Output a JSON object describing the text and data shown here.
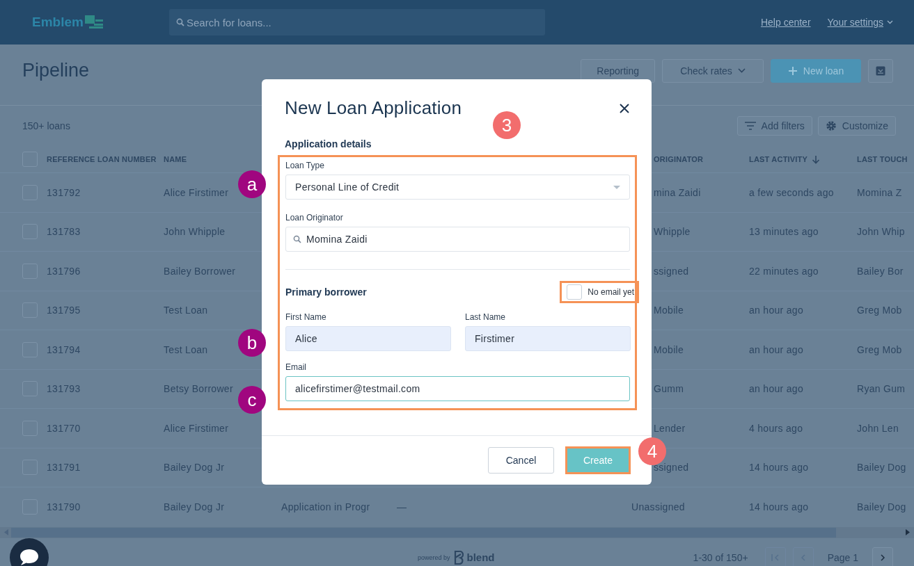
{
  "app": {
    "logo": "Emblem",
    "search_placeholder": "Search for loans...",
    "links": [
      {
        "label": "Help center",
        "kind": "link"
      },
      {
        "label": "Your settings",
        "kind": "menu"
      }
    ]
  },
  "page": {
    "title": "Pipeline",
    "actions": [
      {
        "label": "Reporting",
        "kind": "plain"
      },
      {
        "label": "Check rates",
        "kind": "dropdown"
      },
      {
        "label": "New loan",
        "kind": "primary"
      },
      {
        "kind": "icon"
      }
    ],
    "count": "150+ loans",
    "tools": [
      {
        "label": "Add filters",
        "kind": "filter"
      },
      {
        "label": "Customize",
        "kind": "gear"
      }
    ]
  },
  "table": {
    "all_checked": false,
    "columns": [
      {
        "label": "REFERENCE LOAN NUMBER",
        "sorted": false
      },
      {
        "label": "NAME",
        "sorted": false
      },
      {
        "label": "ORIGINATOR",
        "sorted": false
      },
      {
        "label": "LAST ACTIVITY",
        "sorted": true
      },
      {
        "label": "LAST TOUCH",
        "sorted": false
      }
    ],
    "rows": [
      {
        "checked": false,
        "number": "131792",
        "name": "Alice Firstimer",
        "originator": "mina Zaidi",
        "last_activity": "a few seconds ago",
        "last_touch": "Momina Z"
      },
      {
        "checked": false,
        "number": "131783",
        "name": "John Whipple",
        "originator": "Whipple",
        "last_activity": "13 minutes ago",
        "last_touch": "John Whip"
      },
      {
        "checked": false,
        "number": "131796",
        "name": "Bailey Borrower",
        "originator": "ssigned",
        "last_activity": "22 minutes ago",
        "last_touch": "Bailey Bor"
      },
      {
        "checked": false,
        "number": "131795",
        "name": "Test Loan",
        "originator": "Mobile",
        "last_activity": "an hour ago",
        "last_touch": "Greg Mob"
      },
      {
        "checked": false,
        "number": "131794",
        "name": "Test Loan",
        "originator": "Mobile",
        "last_activity": "an hour ago",
        "last_touch": "Greg Mob"
      },
      {
        "checked": false,
        "number": "131793",
        "name": "Betsy Borrower",
        "originator": "Gumm",
        "last_activity": "an hour ago",
        "last_touch": "Ryan Gum"
      },
      {
        "checked": false,
        "number": "131770",
        "name": "Alice Firstimer",
        "originator": "Lender",
        "last_activity": "4 hours ago",
        "last_touch": "John Len"
      },
      {
        "checked": false,
        "number": "131791",
        "name": "Bailey Dog Jr",
        "originator": "ssigned",
        "last_activity": "14 hours ago",
        "last_touch": "Bailey Dog"
      },
      {
        "checked": false,
        "number": "131790",
        "name": "Bailey Dog Jr",
        "status": "Application in Progr",
        "column_4": "—",
        "originator": "Unassigned",
        "last_activity": "14 hours ago",
        "last_touch": "Bailey Dog"
      }
    ]
  },
  "footer": {
    "powered_by": "powered by",
    "brand": "blend",
    "range": "1-30 of 150+",
    "page": "Page 1"
  },
  "dialog": {
    "title": "New Loan Application",
    "section": "Application details",
    "loan_type": {
      "label": "Loan Type",
      "value": "Personal Line of Credit"
    },
    "originator": {
      "label": "Loan Originator",
      "value": "Momina Zaidi"
    },
    "borrower_heading": "Primary borrower",
    "no_email": {
      "label": "No email yet",
      "checked": false
    },
    "first_name": {
      "label": "First Name",
      "value": "Alice",
      "autofilled": true
    },
    "last_name": {
      "label": "Last Name",
      "value": "Firstimer",
      "autofilled": true
    },
    "email": {
      "label": "Email",
      "value": "alicefirstimer@testmail.com",
      "focused": true
    },
    "cancel": "Cancel",
    "create": "Create"
  },
  "markers": [
    {
      "label": "3",
      "color": "#f26d6d"
    },
    {
      "label": "a",
      "color": "#a0067f"
    },
    {
      "label": "b",
      "color": "#a0067f"
    },
    {
      "label": "c",
      "color": "#a0067f"
    },
    {
      "label": "4",
      "color": "#f26d6d"
    }
  ]
}
